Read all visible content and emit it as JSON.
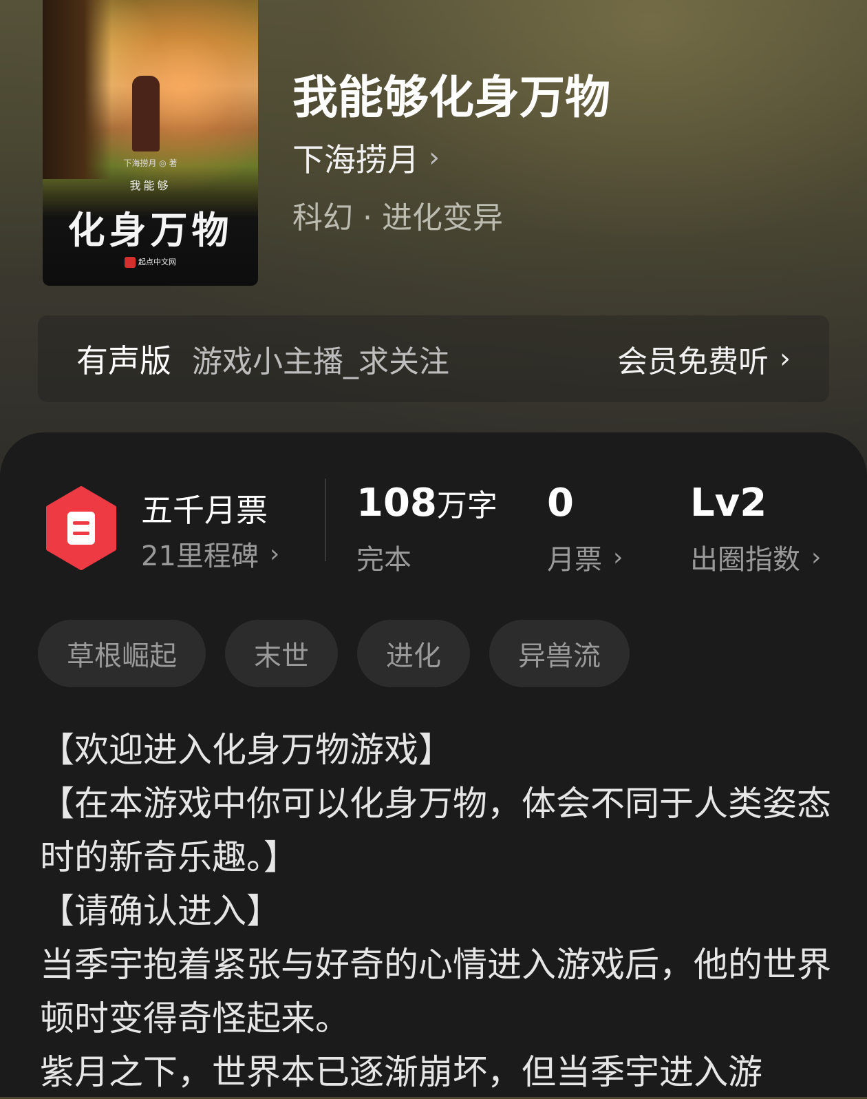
{
  "book": {
    "title": "我能够化身万物",
    "author": "下海捞月",
    "genre": "科幻 · 进化变异",
    "cover": {
      "author_line": "下海捞月 ◎ 著",
      "small_title": "我能够",
      "big_title": "化身万物",
      "publisher": "起点中文网"
    }
  },
  "audio": {
    "label": "有声版",
    "narrator": "游戏小主播_求关注",
    "action": "会员免费听"
  },
  "stats": {
    "ticket_title": "五千月票",
    "ticket_sub": "21里程碑",
    "words_num": "108",
    "words_unit": "万字",
    "words_sub": "完本",
    "monthly_num": "0",
    "monthly_sub": "月票",
    "level_num": "Lv2",
    "level_sub": "出圈指数"
  },
  "tags": [
    "草根崛起",
    "末世",
    "进化",
    "异兽流"
  ],
  "synopsis": [
    "【欢迎进入化身万物游戏】",
    "【在本游戏中你可以化身万物，体会不同于人类姿态时的新奇乐趣。】",
    "【请确认进入】",
    "当季宇抱着紧张与好奇的心情进入游戏后，他的世界顿时变得奇怪起来。",
    "紫月之下，世界本已逐渐崩坏，但当季宇进入游"
  ],
  "colors": {
    "accent_red": "#ee3a43",
    "panel_bg": "#1b1b1b",
    "tag_bg": "#2c2c2c"
  }
}
